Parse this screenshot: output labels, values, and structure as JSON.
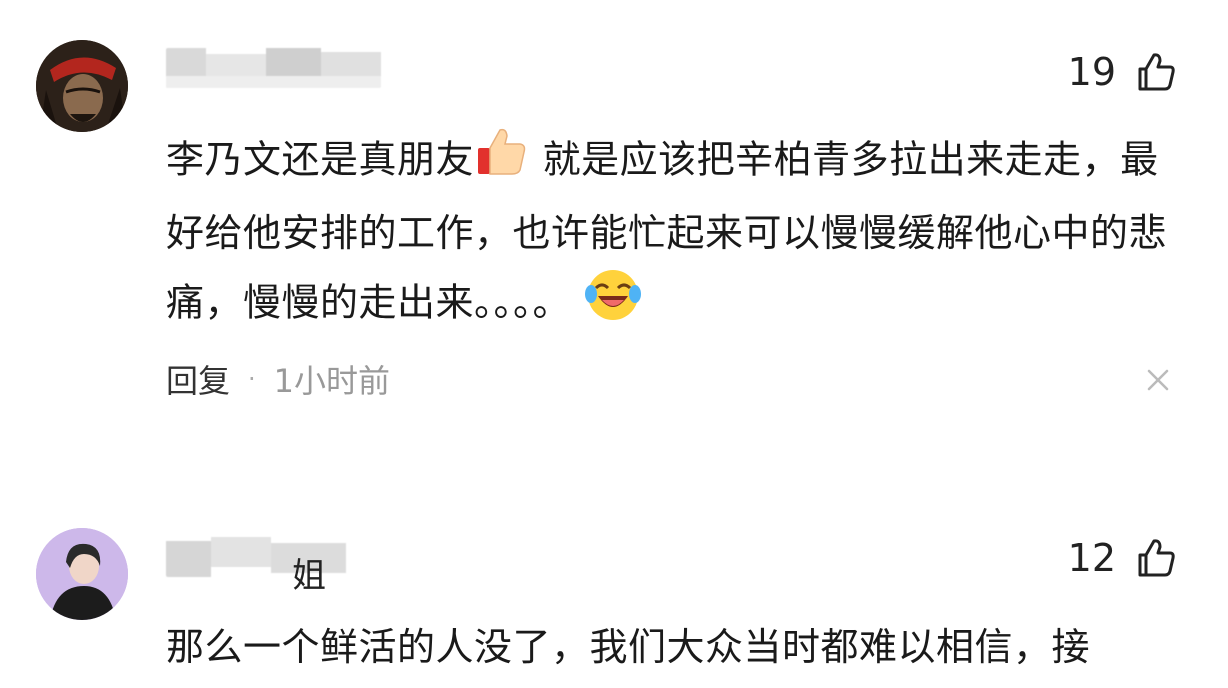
{
  "comments": [
    {
      "likes": "19",
      "text_before_emoji": "李乃文还是真朋友",
      "text_after_emoji": " 就是应该把辛柏青多拉出来走走，最好给他安排的工作，也许能忙起来可以慢慢缓解他心中的悲痛，慢慢的走出来。。。。",
      "emoji_1": "thumbs-up-emoji",
      "emoji_2": "laughing-crying-emoji",
      "reply_label": "回复",
      "separator": "·",
      "time": "1小时前"
    },
    {
      "username_visible_tail": "姐",
      "likes": "12",
      "text": "那么一个鲜活的人没了，我们大众当时都难以相信，接"
    }
  ],
  "colors": {
    "text": "#1a1a1a",
    "meta_time": "#999999",
    "close_icon": "#bbbbbb"
  }
}
